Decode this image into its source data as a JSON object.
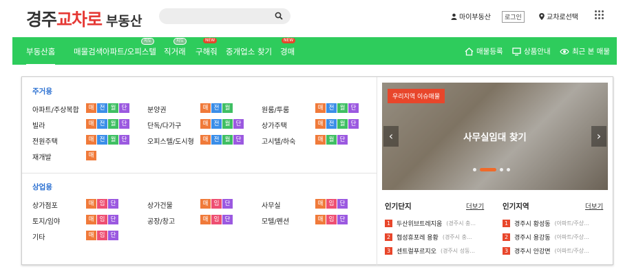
{
  "logo": {
    "part1": "경주",
    "part2": "교차로",
    "part3": "부동산"
  },
  "header": {
    "search_placeholder": "",
    "my_realty": "마이부동산",
    "login": "로그인",
    "region_select": "교차로선택"
  },
  "nav": {
    "items": [
      {
        "label": "부동산홈",
        "active": true
      },
      {
        "label": "매물검색"
      },
      {
        "label": "아파트/오피스텔",
        "tag": "지도",
        "tag_color": "green"
      },
      {
        "label": "직거래",
        "tag": "지도",
        "tag_color": "green"
      },
      {
        "label": "구해줘",
        "tag": "NEW",
        "tag_color": "red"
      },
      {
        "label": "중개업소 찾기"
      },
      {
        "label": "경매",
        "tag": "NEW",
        "tag_color": "red"
      }
    ],
    "right": [
      {
        "label": "매물등록",
        "icon": "home-icon"
      },
      {
        "label": "상품안내",
        "icon": "monitor-icon"
      },
      {
        "label": "최근 본 매물",
        "icon": "eye-icon"
      }
    ]
  },
  "residential": {
    "title": "주거용",
    "items": [
      {
        "label": "아파트/주상복합",
        "chips": [
          "매",
          "전",
          "월",
          "단"
        ]
      },
      {
        "label": "분양권",
        "chips": [
          "매",
          "전",
          "월"
        ]
      },
      {
        "label": "원룸/투룸",
        "chips": [
          "매",
          "전",
          "월",
          "단"
        ]
      },
      {
        "label": "빌라",
        "chips": [
          "매",
          "전",
          "월",
          "단"
        ]
      },
      {
        "label": "단독/다가구",
        "chips": [
          "매",
          "전",
          "월",
          "단"
        ]
      },
      {
        "label": "상가주택",
        "chips": [
          "매",
          "전",
          "월",
          "단"
        ]
      },
      {
        "label": "전원주택",
        "chips": [
          "매",
          "전",
          "월",
          "단"
        ]
      },
      {
        "label": "오피스텔/도시형",
        "chips": [
          "매",
          "전",
          "월",
          "단"
        ]
      },
      {
        "label": "고시텔/하숙",
        "chips": [
          "매",
          "월",
          "단"
        ]
      },
      {
        "label": "재개발",
        "chips": [
          "매"
        ]
      }
    ]
  },
  "commercial": {
    "title": "상업용",
    "items": [
      {
        "label": "상가점포",
        "chips": [
          "매",
          "임",
          "단"
        ]
      },
      {
        "label": "상가건물",
        "chips": [
          "매",
          "임",
          "단"
        ]
      },
      {
        "label": "사무실",
        "chips": [
          "매",
          "임",
          "단"
        ]
      },
      {
        "label": "토지/임야",
        "chips": [
          "매",
          "임",
          "단"
        ]
      },
      {
        "label": "공장/창고",
        "chips": [
          "매",
          "임",
          "단"
        ]
      },
      {
        "label": "모텔/펜션",
        "chips": [
          "매",
          "임",
          "단"
        ]
      },
      {
        "label": "기타",
        "chips": [
          "매",
          "임",
          "단"
        ]
      }
    ]
  },
  "banner": {
    "badge": "우리지역 이슈매물",
    "headline": "사무실임대 찾기",
    "prev": "‹",
    "next": "›"
  },
  "popular_complex": {
    "title": "인기단지",
    "more": "더보기",
    "items": [
      {
        "rank": "1",
        "name": "두산위브트레지움",
        "sub": "(경주시 충..."
      },
      {
        "rank": "2",
        "name": "협성휴포레 용황",
        "sub": "(경주시 충..."
      },
      {
        "rank": "3",
        "name": "센트럴푸르지오",
        "sub": "(경주시 성동..."
      }
    ]
  },
  "popular_region": {
    "title": "인기지역",
    "more": "더보기",
    "items": [
      {
        "rank": "1",
        "name": "경주시 황성동",
        "sub": "(아파트/주상..."
      },
      {
        "rank": "2",
        "name": "경주시 용강동",
        "sub": "(아파트/주상..."
      },
      {
        "rank": "3",
        "name": "경주시 안강면",
        "sub": "(아파트/주상..."
      }
    ]
  },
  "colors": {
    "nav_green": "#2ecc5c",
    "logo_red": "#e53935",
    "title_blue": "#2a6fd1",
    "accent_orange": "#e8462b"
  }
}
